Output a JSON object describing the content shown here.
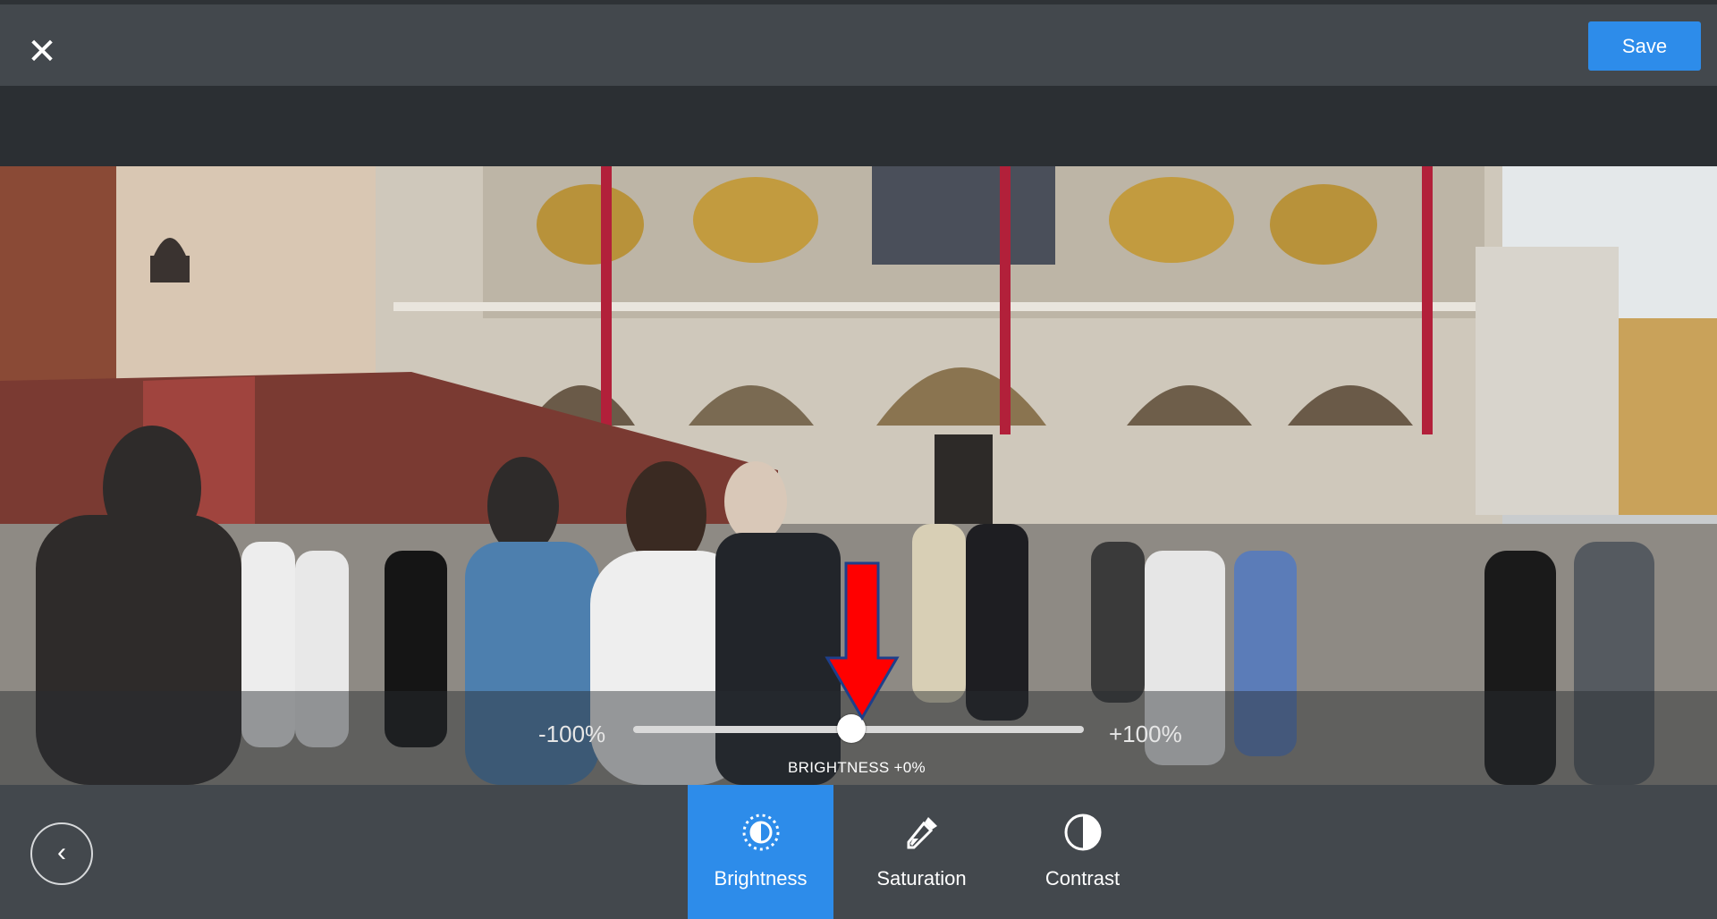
{
  "header": {
    "close_icon": "close-icon",
    "save_label": "Save"
  },
  "photo": {
    "description_icon": "photo"
  },
  "slider": {
    "min_label": "-100%",
    "max_label": "+100%",
    "value_label": "BRIGHTNESS +0%",
    "value": 0
  },
  "toolbar": {
    "back_icon": "chevron-left-icon",
    "tools": [
      {
        "label": "Brightness",
        "icon": "brightness-icon",
        "active": true
      },
      {
        "label": "Saturation",
        "icon": "eyedropper-icon",
        "active": false
      },
      {
        "label": "Contrast",
        "icon": "contrast-icon",
        "active": false
      }
    ]
  },
  "colors": {
    "accent": "#2d8cea",
    "bar": "#43484d",
    "annotation_arrow": "#ff0000"
  }
}
